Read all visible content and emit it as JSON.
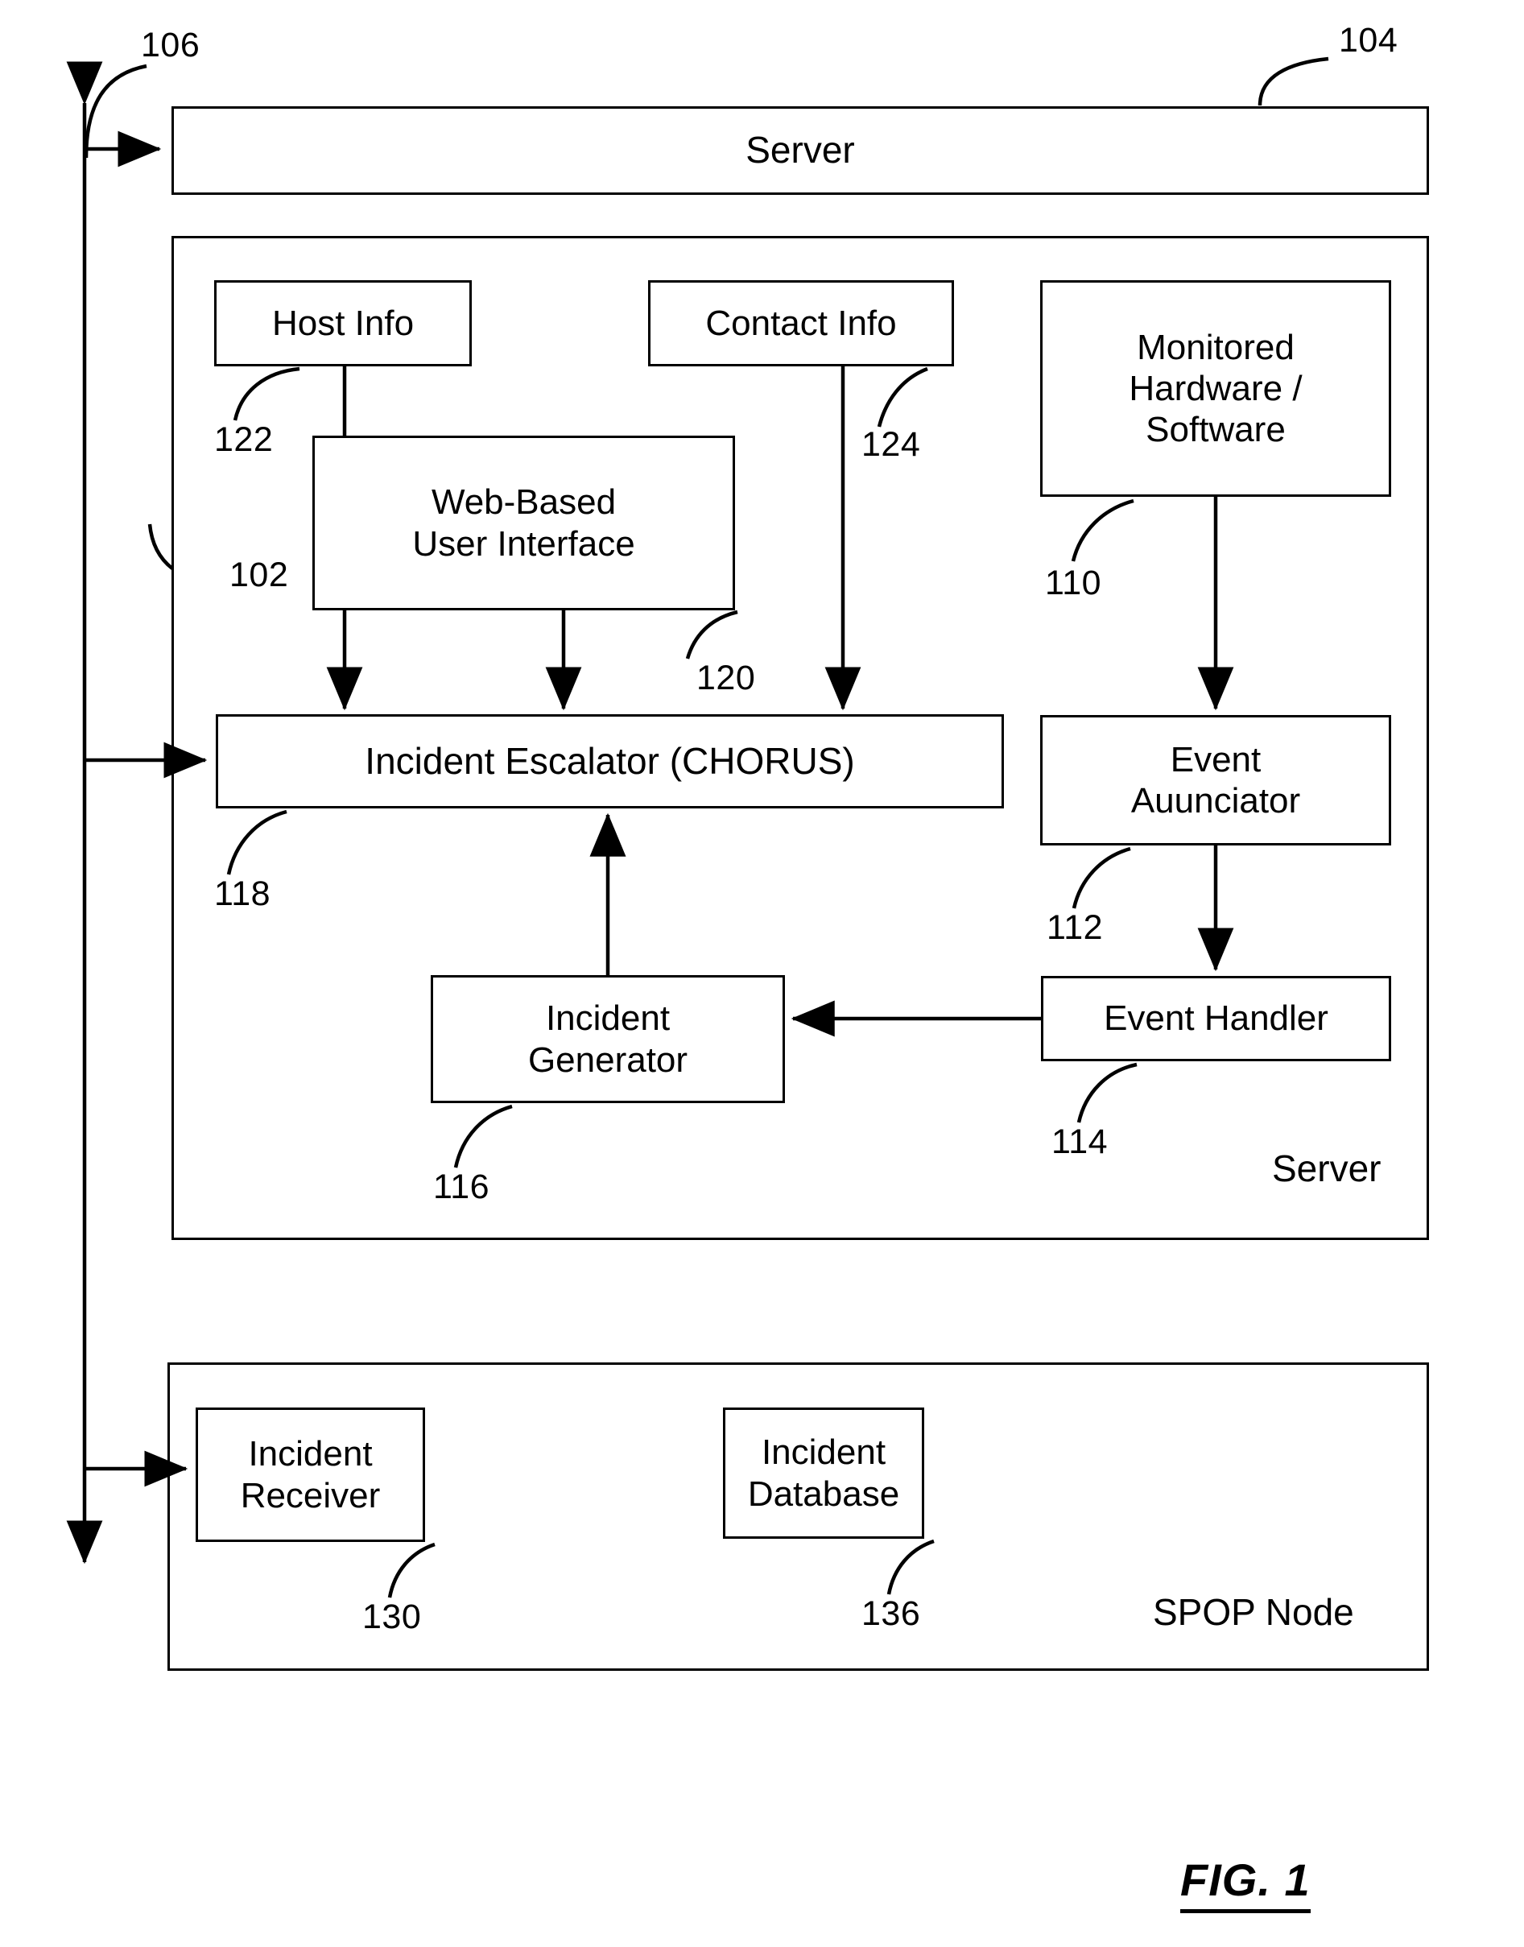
{
  "figure": {
    "label": "FIG. 1",
    "title": "Incident escalation system block diagram"
  },
  "containers": [
    {
      "id": "server-bar",
      "name": "Server",
      "ref": "104",
      "label": "Server"
    },
    {
      "id": "server-system",
      "name": "Server",
      "ref": "102",
      "label": "Server"
    },
    {
      "id": "spop-node",
      "name": "SPOP Node",
      "ref": "",
      "label": "SPOP Node"
    }
  ],
  "bus": {
    "ref": "106"
  },
  "nodes": [
    {
      "id": "host-info",
      "label": "Host Info",
      "ref": "122"
    },
    {
      "id": "contact-info",
      "label": "Contact Info",
      "ref": "124"
    },
    {
      "id": "monitored-hw-sw",
      "label": "Monitored\nHardware /\nSoftware",
      "ref": "110",
      "lines": [
        "Monitored",
        "Hardware /",
        "Software"
      ]
    },
    {
      "id": "web-ui",
      "label": "Web-Based\nUser Interface",
      "ref": "120",
      "lines": [
        "Web-Based",
        "User Interface"
      ]
    },
    {
      "id": "incident-escalator",
      "label": "Incident Escalator (CHORUS)",
      "ref": "118",
      "lines": [
        "Incident Escalator (CHORUS)"
      ]
    },
    {
      "id": "event-annunciator",
      "label": "Event\nAuunciator",
      "ref": "112",
      "lines": [
        "Event",
        "Auunciator"
      ]
    },
    {
      "id": "incident-generator",
      "label": "Incident\nGenerator",
      "ref": "116",
      "lines": [
        "Incident",
        "Generator"
      ]
    },
    {
      "id": "event-handler",
      "label": "Event Handler",
      "ref": "114",
      "lines": [
        "Event Handler"
      ]
    },
    {
      "id": "incident-receiver",
      "label": "Incident\nReceiver",
      "ref": "130",
      "lines": [
        "Incident",
        "Receiver"
      ]
    },
    {
      "id": "incident-database",
      "label": "Incident\nDatabase",
      "ref": "136",
      "lines": [
        "Incident",
        "Database"
      ]
    }
  ],
  "text": {
    "server_bar_label": "Server",
    "server_bar_ref": "104",
    "bus_ref": "106",
    "system_ref": "102",
    "server_inner_label": "Server",
    "spop_label": "SPOP Node",
    "host_info": "Host Info",
    "host_info_ref": "122",
    "contact_info": "Contact Info",
    "contact_info_ref": "124",
    "monitored_l1": "Monitored",
    "monitored_l2": "Hardware /",
    "monitored_l3": "Software",
    "monitored_ref": "110",
    "webui_l1": "Web-Based",
    "webui_l2": "User Interface",
    "webui_ref": "120",
    "escalator": "Incident Escalator (CHORUS)",
    "escalator_ref": "118",
    "annunciator_l1": "Event",
    "annunciator_l2": "Auunciator",
    "annunciator_ref": "112",
    "generator_l1": "Incident",
    "generator_l2": "Generator",
    "generator_ref": "116",
    "handler": "Event Handler",
    "handler_ref": "114",
    "receiver_l1": "Incident",
    "receiver_l2": "Receiver",
    "receiver_ref": "130",
    "database_l1": "Incident",
    "database_l2": "Database",
    "database_ref": "136",
    "fig": "FIG. 1"
  },
  "colors": {
    "ink": "#000000",
    "paper": "#ffffff"
  }
}
